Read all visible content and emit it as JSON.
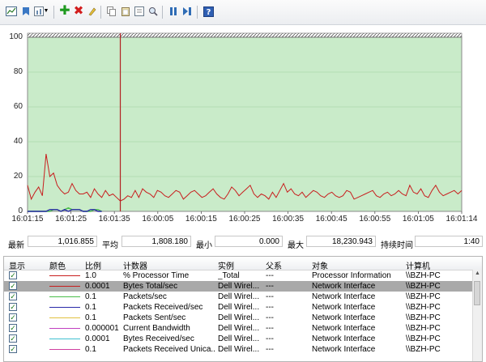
{
  "colors": {
    "plot_bg": "#c9ebc9",
    "grid": "#9ccf9c",
    "series_main": "#c81e1e",
    "cursor_line": "#b22222",
    "selected_row": "#a9a9a9"
  },
  "toolbar": {
    "icons": [
      "graph-view-icon",
      "freeze-icon",
      "change-graph-type-icon",
      "dropdown-icon",
      "add-counter-icon",
      "delete-counter-icon",
      "highlight-icon",
      "copy-properties-icon",
      "paste-list-icon",
      "properties-icon",
      "zoom-icon",
      "pause-icon",
      "update-data-icon",
      "help-icon"
    ]
  },
  "chart_data": {
    "type": "line",
    "ylim": [
      0,
      100
    ],
    "y_ticks": [
      "100",
      "80",
      "60",
      "40",
      "20",
      "0"
    ],
    "x_ticks": [
      "16:01:15",
      "16:01:25",
      "16:01:35",
      "16:00:05",
      "16:00:15",
      "16:00:25",
      "16:00:35",
      "16:00:45",
      "16:00:55",
      "16:01:05",
      "16:01:14"
    ],
    "cursor_sample": 25,
    "series": [
      {
        "color": "#c81e1e",
        "values": [
          15,
          7,
          11,
          14,
          9,
          33,
          20,
          22,
          15,
          12,
          10,
          11,
          16,
          12,
          10,
          10,
          11,
          8,
          13,
          10,
          8,
          12,
          9,
          10,
          8,
          6,
          7,
          9,
          8,
          12,
          8,
          13,
          11,
          10,
          8,
          12,
          11,
          9,
          8,
          10,
          12,
          11,
          7,
          9,
          11,
          12,
          10,
          8,
          9,
          11,
          13,
          10,
          8,
          7,
          10,
          14,
          12,
          9,
          11,
          13,
          15,
          10,
          8,
          10,
          9,
          7,
          11,
          8,
          12,
          16,
          11,
          13,
          10,
          9,
          11,
          8,
          10,
          12,
          11,
          9,
          8,
          10,
          11,
          9,
          8,
          9,
          12,
          11,
          7,
          8,
          9,
          10,
          11,
          12,
          9,
          8,
          10,
          11,
          9,
          10,
          12,
          10,
          9,
          15,
          11,
          10,
          13,
          9,
          8,
          12,
          15,
          11,
          9,
          10,
          11,
          12,
          10,
          12
        ]
      },
      {
        "color": "#4bbf4b",
        "values": [
          0,
          0,
          0,
          0,
          0,
          0,
          0,
          1,
          1,
          0,
          1,
          2,
          1,
          1,
          1,
          0,
          0,
          0,
          1,
          1,
          0
        ]
      },
      {
        "color": "#2a2aa8",
        "values": [
          0,
          0,
          0,
          0,
          0,
          0,
          1,
          1,
          1,
          0,
          1,
          0,
          1,
          1,
          1,
          0,
          0,
          1,
          1,
          0,
          0
        ]
      }
    ]
  },
  "stats": {
    "last_label": "最新",
    "last_value": "1,016.855",
    "avg_label": "平均",
    "avg_value": "1,808.180",
    "min_label": "最小",
    "min_value": "0.000",
    "max_label": "最大",
    "max_value": "18,230.943",
    "duration_label": "持续时间",
    "duration_value": "1:40"
  },
  "table": {
    "headers": {
      "show": "显示",
      "color": "颜色",
      "scale": "比例",
      "counter": "计数器",
      "instance": "实例",
      "parent": "父系",
      "object": "对象",
      "computer": "计算机"
    },
    "rows": [
      {
        "scale": "1.0",
        "counter": "% Processor Time",
        "instance": "_Total",
        "parent": "---",
        "object": "Processor Information",
        "computer": "\\\\BZH-PC",
        "color": "#c81e1e",
        "selected": false
      },
      {
        "scale": "0.0001",
        "counter": "Bytes Total/sec",
        "instance": "Dell Wirel...",
        "parent": "---",
        "object": "Network Interface",
        "computer": "\\\\BZH-PC",
        "color": "#c81e1e",
        "selected": true
      },
      {
        "scale": "0.1",
        "counter": "Packets/sec",
        "instance": "Dell Wirel...",
        "parent": "---",
        "object": "Network Interface",
        "computer": "\\\\BZH-PC",
        "color": "#4bbf4b",
        "selected": false
      },
      {
        "scale": "0.1",
        "counter": "Packets Received/sec",
        "instance": "Dell Wirel...",
        "parent": "---",
        "object": "Network Interface",
        "computer": "\\\\BZH-PC",
        "color": "#2a2aa8",
        "selected": false
      },
      {
        "scale": "0.1",
        "counter": "Packets Sent/sec",
        "instance": "Dell Wirel...",
        "parent": "---",
        "object": "Network Interface",
        "computer": "\\\\BZH-PC",
        "color": "#e0c040",
        "selected": false
      },
      {
        "scale": "0.000001",
        "counter": "Current Bandwidth",
        "instance": "Dell Wirel...",
        "parent": "---",
        "object": "Network Interface",
        "computer": "\\\\BZH-PC",
        "color": "#c040c0",
        "selected": false
      },
      {
        "scale": "0.0001",
        "counter": "Bytes Received/sec",
        "instance": "Dell Wirel...",
        "parent": "---",
        "object": "Network Interface",
        "computer": "\\\\BZH-PC",
        "color": "#40c0d0",
        "selected": false
      },
      {
        "scale": "0.1",
        "counter": "Packets Received Unica...",
        "instance": "Dell Wirel...",
        "parent": "---",
        "object": "Network Interface",
        "computer": "\\\\BZH-PC",
        "color": "#d040a0",
        "selected": false
      }
    ]
  }
}
